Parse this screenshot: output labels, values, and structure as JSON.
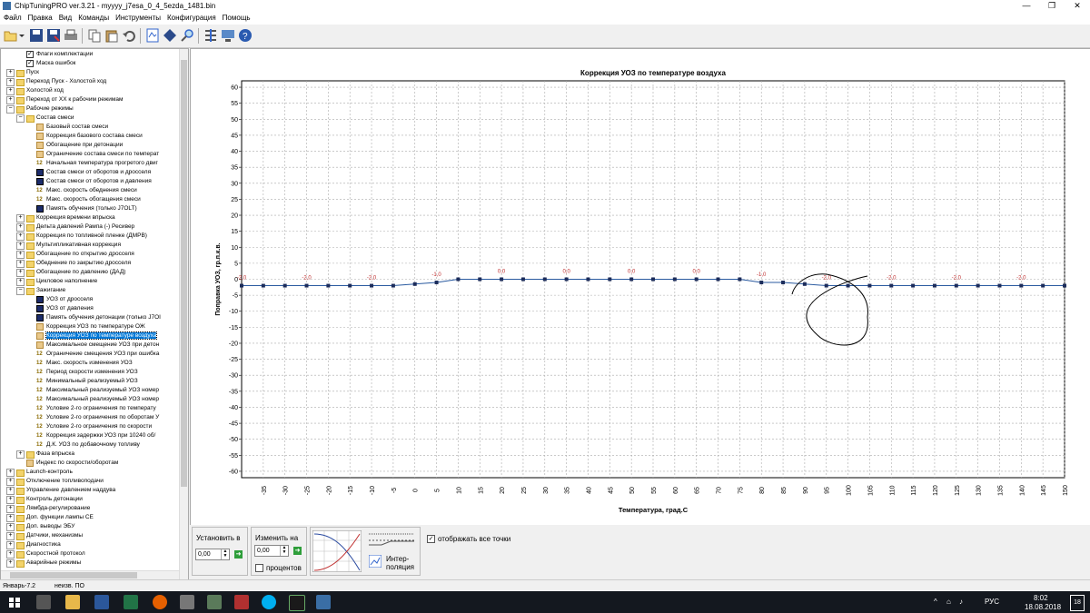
{
  "window": {
    "title": "ChipTuningPRO ver.3.21 - myyyy_j7esa_0_4_5ezda_1481.bin",
    "minimize": "—",
    "restore": "❐",
    "close": "✕"
  },
  "menu": [
    "Файл",
    "Правка",
    "Вид",
    "Команды",
    "Инструменты",
    "Конфигурация",
    "Помощь"
  ],
  "toolbar_icons": [
    "open-icon",
    "dropdown-icon",
    "save-icon",
    "save-as-icon",
    "print-icon",
    "copy-icon",
    "paste-icon",
    "undo-icon",
    "read-icon",
    "write-icon",
    "find-icon",
    "compare-icon",
    "download-icon",
    "help-icon"
  ],
  "tree": [
    {
      "label": "Флаги комплектации",
      "indent": 2,
      "icon": "check",
      "exp": ""
    },
    {
      "label": "Маска ошибок",
      "indent": 2,
      "icon": "check",
      "exp": ""
    },
    {
      "label": "Пуск",
      "indent": 1,
      "icon": "folder",
      "exp": "+"
    },
    {
      "label": "Переход Пуск - Холостой ход",
      "indent": 1,
      "icon": "folder",
      "exp": "+"
    },
    {
      "label": "Холостой ход",
      "indent": 1,
      "icon": "folder",
      "exp": "+"
    },
    {
      "label": "Переход от ХХ к рабочим режимам",
      "indent": 1,
      "icon": "folder",
      "exp": "+"
    },
    {
      "label": "Рабочие режимы",
      "indent": 1,
      "icon": "folder",
      "exp": "−"
    },
    {
      "label": "Состав смеси",
      "indent": 2,
      "icon": "folder",
      "exp": "−"
    },
    {
      "label": "Базовый состав смеси",
      "indent": 3,
      "icon": "curve",
      "exp": ""
    },
    {
      "label": "Коррекция базового состава смеси",
      "indent": 3,
      "icon": "curve",
      "exp": ""
    },
    {
      "label": "Обогащение при детонации",
      "indent": 3,
      "icon": "curve",
      "exp": ""
    },
    {
      "label": "Ограничение состава смеси по температ",
      "indent": 3,
      "icon": "curve",
      "exp": ""
    },
    {
      "label": "Начальная температура прогретого двиг",
      "indent": 3,
      "icon": "num",
      "exp": ""
    },
    {
      "label": "Состав смеси от оборотов и дросселя",
      "indent": 3,
      "icon": "grid",
      "exp": ""
    },
    {
      "label": "Состав смеси от оборотов и давления",
      "indent": 3,
      "icon": "grid",
      "exp": ""
    },
    {
      "label": "Макс. скорость обеднения смеси",
      "indent": 3,
      "icon": "num",
      "exp": ""
    },
    {
      "label": "Макс. скорость обогащения смеси",
      "indent": 3,
      "icon": "num",
      "exp": ""
    },
    {
      "label": "Память обучения (только J7OLT)",
      "indent": 3,
      "icon": "grid",
      "exp": ""
    },
    {
      "label": "Коррекция времени впрыска",
      "indent": 2,
      "icon": "folder",
      "exp": "+"
    },
    {
      "label": "Дельта давлений Рампа (-) Ресивер",
      "indent": 2,
      "icon": "folder",
      "exp": "+"
    },
    {
      "label": "Коррекция по топливной пленке (ДМРВ)",
      "indent": 2,
      "icon": "folder",
      "exp": "+"
    },
    {
      "label": "Мультипликативная коррекция",
      "indent": 2,
      "icon": "folder",
      "exp": "+"
    },
    {
      "label": "Обогащение по открытию дросселя",
      "indent": 2,
      "icon": "folder",
      "exp": "+"
    },
    {
      "label": "Обеднение по закрытию дросселя",
      "indent": 2,
      "icon": "folder",
      "exp": "+"
    },
    {
      "label": "Обогащение по давлению (ДАД)",
      "indent": 2,
      "icon": "folder",
      "exp": "+"
    },
    {
      "label": "Цикловое наполнение",
      "indent": 2,
      "icon": "folder",
      "exp": "+"
    },
    {
      "label": "Зажигание",
      "indent": 2,
      "icon": "folder",
      "exp": "−"
    },
    {
      "label": "УОЗ от дросселя",
      "indent": 3,
      "icon": "grid",
      "exp": ""
    },
    {
      "label": "УОЗ от давления",
      "indent": 3,
      "icon": "grid",
      "exp": ""
    },
    {
      "label": "Память обучения детонации (только J7OI",
      "indent": 3,
      "icon": "grid",
      "exp": ""
    },
    {
      "label": "Коррекция УОЗ по температуре ОЖ",
      "indent": 3,
      "icon": "curve",
      "exp": ""
    },
    {
      "label": "Коррекция УОЗ по температуре воздуха",
      "indent": 3,
      "icon": "curve",
      "exp": "",
      "selected": true
    },
    {
      "label": "Максимальное смещение УОЗ при детон",
      "indent": 3,
      "icon": "curve",
      "exp": ""
    },
    {
      "label": "Ограничение смещения УОЗ при ошибка",
      "indent": 3,
      "icon": "num",
      "exp": ""
    },
    {
      "label": "Макс. скорость изменения УОЗ",
      "indent": 3,
      "icon": "num",
      "exp": ""
    },
    {
      "label": "Период скорости изменения УОЗ",
      "indent": 3,
      "icon": "num",
      "exp": ""
    },
    {
      "label": "Минимальный реализуемый УОЗ",
      "indent": 3,
      "icon": "num",
      "exp": ""
    },
    {
      "label": "Максимальный реализуемый УОЗ номер",
      "indent": 3,
      "icon": "num",
      "exp": ""
    },
    {
      "label": "Максимальный реализуемый УОЗ номер",
      "indent": 3,
      "icon": "num",
      "exp": ""
    },
    {
      "label": "Условие 2-го ограничения по температу",
      "indent": 3,
      "icon": "num",
      "exp": ""
    },
    {
      "label": "Условие 2-го ограничения по оборотам У",
      "indent": 3,
      "icon": "num",
      "exp": ""
    },
    {
      "label": "Условие 2-го ограничения по скорости",
      "indent": 3,
      "icon": "num",
      "exp": ""
    },
    {
      "label": "Коррекция задержки УОЗ при 10240 об/",
      "indent": 3,
      "icon": "num",
      "exp": ""
    },
    {
      "label": "Д.К. УОЗ по добавочному топливу",
      "indent": 3,
      "icon": "num",
      "exp": ""
    },
    {
      "label": "Фаза впрыска",
      "indent": 2,
      "icon": "folder",
      "exp": "+"
    },
    {
      "label": "Индекс по скорости/оборотам",
      "indent": 2,
      "icon": "curve",
      "exp": ""
    },
    {
      "label": "Launch-контроль",
      "indent": 1,
      "icon": "folder",
      "exp": "+"
    },
    {
      "label": "Отключение топливоподачи",
      "indent": 1,
      "icon": "folder",
      "exp": "+"
    },
    {
      "label": "Управление давлением наддува",
      "indent": 1,
      "icon": "folder",
      "exp": "+"
    },
    {
      "label": "Контроль детонации",
      "indent": 1,
      "icon": "folder",
      "exp": "+"
    },
    {
      "label": "Лямбда-регулирование",
      "indent": 1,
      "icon": "folder",
      "exp": "+"
    },
    {
      "label": "Доп. функции лампы CE",
      "indent": 1,
      "icon": "folder",
      "exp": "+"
    },
    {
      "label": "Доп. выводы ЭБУ",
      "indent": 1,
      "icon": "folder",
      "exp": "+"
    },
    {
      "label": "Датчики, механизмы",
      "indent": 1,
      "icon": "folder",
      "exp": "+"
    },
    {
      "label": "Диагностика",
      "indent": 1,
      "icon": "folder",
      "exp": "+"
    },
    {
      "label": "Скоростной протокол",
      "indent": 1,
      "icon": "folder",
      "exp": "+"
    },
    {
      "label": "Аварийные режимы",
      "indent": 1,
      "icon": "folder",
      "exp": "+"
    }
  ],
  "chart_data": {
    "type": "line",
    "title": "Коррекция УОЗ по температуре воздуха",
    "xlabel": "Температура, град.С",
    "ylabel": "Поправка УОЗ, гр.п.к.в.",
    "xlim": [
      -40,
      150
    ],
    "ylim": [
      -62,
      62
    ],
    "grid": true,
    "x_ticks": [
      -35,
      -30,
      -25,
      -20,
      -15,
      -10,
      -5,
      0,
      5,
      10,
      15,
      20,
      25,
      30,
      35,
      40,
      45,
      50,
      55,
      60,
      65,
      70,
      75,
      80,
      85,
      90,
      95,
      100,
      105,
      110,
      115,
      120,
      125,
      130,
      135,
      140,
      145,
      150
    ],
    "y_ticks": [
      60,
      55,
      50,
      45,
      40,
      35,
      30,
      25,
      20,
      15,
      10,
      5,
      0,
      -5,
      -10,
      -15,
      -20,
      -25,
      -30,
      -35,
      -40,
      -45,
      -50,
      -55,
      -60
    ],
    "series": [
      {
        "x": [
          -40,
          -35,
          -30,
          -25,
          -20,
          -15,
          -10,
          -5,
          0,
          5,
          10,
          15,
          20,
          25,
          30,
          35,
          40,
          45,
          50,
          55,
          60,
          65,
          70,
          75,
          80,
          85,
          90,
          95,
          100,
          105,
          110,
          115,
          120,
          125,
          130,
          135,
          140,
          145,
          150
        ],
        "values": [
          -2,
          -2,
          -2,
          -2,
          -2,
          -2,
          -2,
          -2,
          -1.5,
          -1,
          0,
          0,
          0,
          0,
          0,
          0,
          0,
          0,
          0,
          0,
          0,
          0,
          0,
          0,
          -1,
          -1,
          -1.5,
          -2,
          -2,
          -2,
          -2,
          -2,
          -2,
          -2,
          -2,
          -2,
          -2,
          -2,
          -2
        ]
      }
    ],
    "data_labels": [
      {
        "x": -40,
        "text": "-2,0"
      },
      {
        "x": -25,
        "text": "-2,0"
      },
      {
        "x": -10,
        "text": "-2,0"
      },
      {
        "x": 5,
        "text": "-1,0"
      },
      {
        "x": 20,
        "text": "0,0"
      },
      {
        "x": 35,
        "text": "0,0"
      },
      {
        "x": 50,
        "text": "0,0"
      },
      {
        "x": 65,
        "text": "0,0"
      },
      {
        "x": 80,
        "text": "-1,0"
      },
      {
        "x": 95,
        "text": "-2,0"
      },
      {
        "x": 110,
        "text": "-2,0"
      },
      {
        "x": 125,
        "text": "-2,0"
      },
      {
        "x": 140,
        "text": "-2,0"
      }
    ]
  },
  "bottom": {
    "set_label": "Установить в",
    "set_value": "0,00",
    "change_label": "Изменить на",
    "change_value": "0,00",
    "percent_label": "процентов",
    "interp_label_1": "Интер-",
    "interp_label_2": "поляция",
    "show_points_label": "отображать все точки",
    "show_points_checked": "✓"
  },
  "status": {
    "left": "Январь-7.2",
    "right": "неизв. ПО"
  },
  "taskbar": {
    "lang": "РУС",
    "time": "8:02",
    "date": "18.08.2018",
    "notify_count": "18",
    "apps": [
      "start-icon",
      "search-icon",
      "task-view-icon",
      "explorer-icon",
      "excel-icon",
      "firefox-icon",
      "app-icon-1",
      "app-icon-2",
      "app-icon-3",
      "skype-icon",
      "chiptuning-icon",
      "app-icon-4"
    ]
  }
}
